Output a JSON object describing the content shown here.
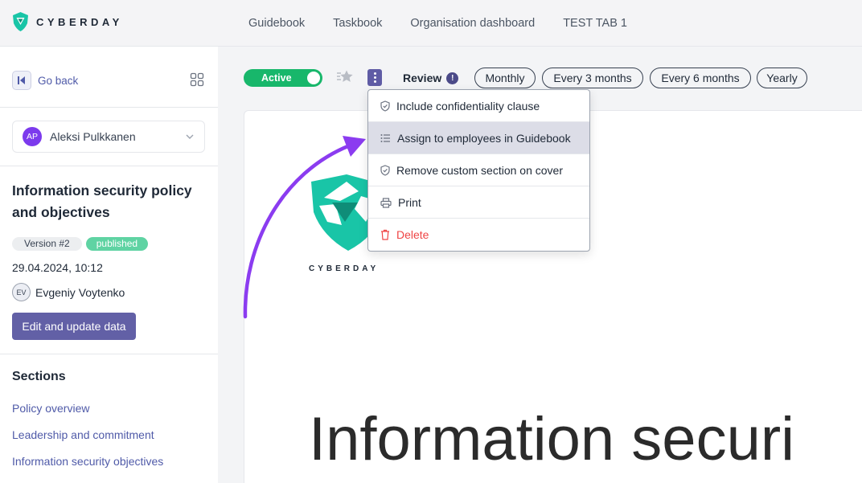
{
  "brand": {
    "name": "CYBERDAY"
  },
  "nav": {
    "tabs": [
      {
        "label": "Guidebook"
      },
      {
        "label": "Taskbook"
      },
      {
        "label": "Organisation dashboard"
      },
      {
        "label": "TEST TAB 1"
      }
    ]
  },
  "sidebar": {
    "go_back_label": "Go back",
    "user": {
      "initials": "AP",
      "name": "Aleksi Pulkkanen"
    },
    "document": {
      "title": "Information security policy and objectives",
      "version": "Version #2",
      "status": "published",
      "date": "29.04.2024, 10:12",
      "author": {
        "initials": "EV",
        "name": "Evgeniy Voytenko"
      }
    },
    "edit_button_label": "Edit and update data",
    "sections_title": "Sections",
    "sections": [
      {
        "label": "Policy overview"
      },
      {
        "label": "Leadership and commitment"
      },
      {
        "label": "Information security objectives"
      }
    ]
  },
  "toolbar": {
    "status_toggle": {
      "label": "Active",
      "on": true
    },
    "review_label": "Review",
    "review_info": "!",
    "intervals": [
      {
        "label": "Monthly"
      },
      {
        "label": "Every 3 months"
      },
      {
        "label": "Every 6 months"
      },
      {
        "label": "Yearly"
      }
    ]
  },
  "menu": {
    "items": [
      {
        "label": "Include confidentiality clause",
        "icon": "shield-icon"
      },
      {
        "label": "Assign to employees in Guidebook",
        "icon": "list-icon",
        "highlighted": true
      },
      {
        "label": "Remove custom section on cover",
        "icon": "shield-icon"
      },
      {
        "label": "Print",
        "icon": "printer-icon"
      },
      {
        "label": "Delete",
        "icon": "trash-icon"
      }
    ]
  },
  "preview": {
    "brand_text": "CYBERDAY",
    "heading": "Information securi"
  },
  "colors": {
    "accent": "#6260a6",
    "active_green": "#18b76b",
    "published_badge": "#5fd3a3",
    "brand_teal": "#19c5a7",
    "annotation_arrow": "#8b3cf0",
    "danger": "#ef4444",
    "link": "#4f5aa8"
  }
}
